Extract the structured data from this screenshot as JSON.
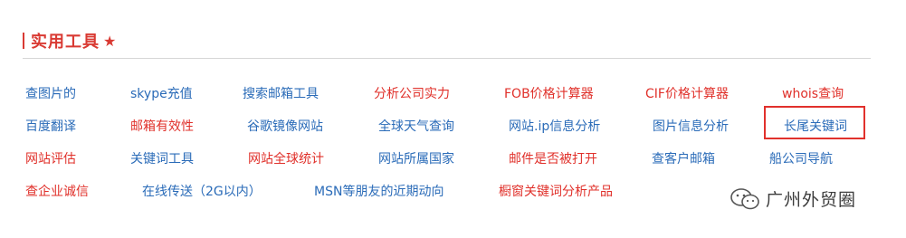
{
  "section": {
    "title": "实用工具",
    "star_icon": "star-icon"
  },
  "colors": {
    "accent": "#d93a33",
    "link_blue": "#2a6bb8",
    "link_red": "#e0302a",
    "highlight": "#e1312c"
  },
  "links": {
    "r1": [
      "查图片的",
      "skype充值",
      "搜索邮箱工具",
      "分析公司实力",
      "FOB价格计算器",
      "CIF价格计算器",
      "whois查询"
    ],
    "r2": [
      "百度翻译",
      "邮箱有效性",
      "谷歌镜像网站",
      "全球天气查询",
      "网站.ip信息分析",
      "图片信息分析",
      "长尾关键词"
    ],
    "r3": [
      "网站评估",
      "关键词工具",
      "网站全球统计",
      "网站所属国家",
      "邮件是否被打开",
      "查客户邮箱",
      "船公司导航"
    ],
    "r4": [
      "查企业诚信",
      "在线传送（2G以内）",
      "MSN等朋友的近期动向",
      "橱窗关键词分析产品"
    ]
  },
  "watermark": {
    "text": "广州外贸圈",
    "icon": "wechat-icon"
  }
}
